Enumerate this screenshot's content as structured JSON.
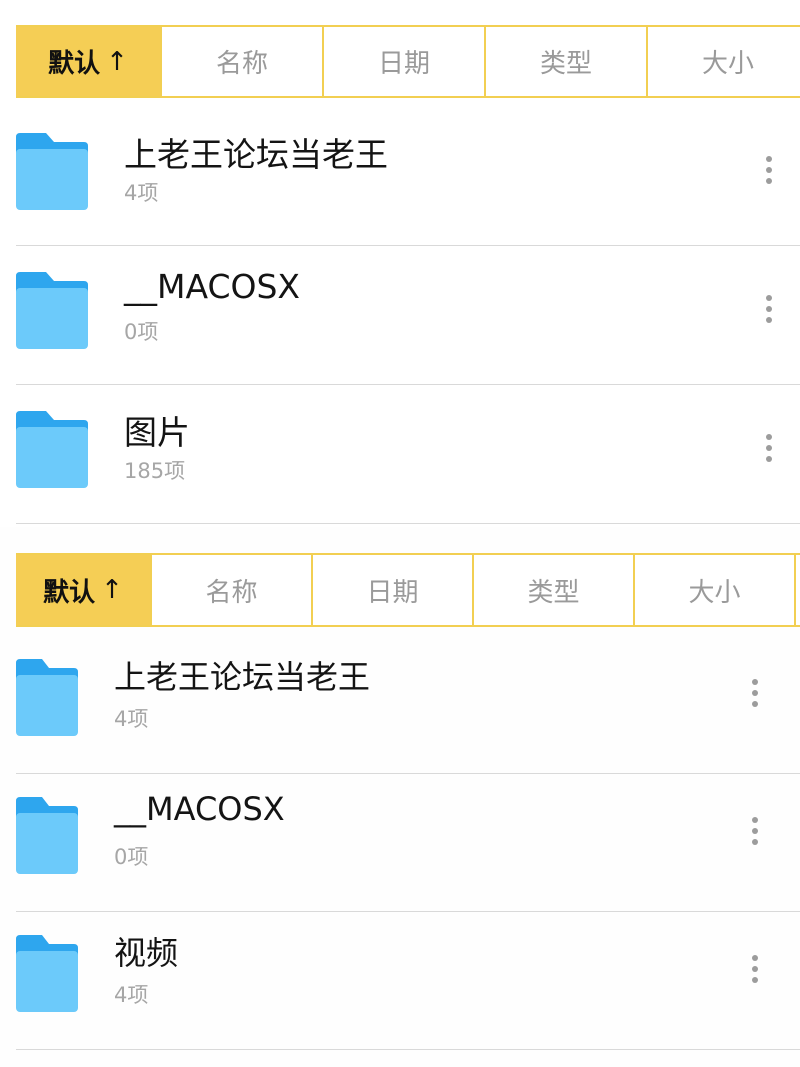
{
  "colors": {
    "accent": "#f5ce55",
    "tab_border": "#f2cf52",
    "folder_front": "#6ccafa",
    "folder_tab": "#2ea6ee",
    "muted_text": "#a6a6a6"
  },
  "panels": [
    {
      "sort_tabs": [
        {
          "label": "默认",
          "arrow": "↑",
          "active": true
        },
        {
          "label": "名称",
          "active": false
        },
        {
          "label": "日期",
          "active": false
        },
        {
          "label": "类型",
          "active": false
        },
        {
          "label": "大小",
          "active": false
        }
      ],
      "files": [
        {
          "name": "上老王论坛当老王",
          "count": "4项",
          "icon": "folder-icon"
        },
        {
          "name": "__MACOSX",
          "count": "0项",
          "icon": "folder-icon"
        },
        {
          "name": "图片",
          "count": "185项",
          "icon": "folder-icon"
        }
      ]
    },
    {
      "sort_tabs": [
        {
          "label": "默认",
          "arrow": "↑",
          "active": true
        },
        {
          "label": "名称",
          "active": false
        },
        {
          "label": "日期",
          "active": false
        },
        {
          "label": "类型",
          "active": false
        },
        {
          "label": "大小",
          "active": false
        }
      ],
      "files": [
        {
          "name": "上老王论坛当老王",
          "count": "4项",
          "icon": "folder-icon"
        },
        {
          "name": "__MACOSX",
          "count": "0项",
          "icon": "folder-icon"
        },
        {
          "name": "视频",
          "count": "4项",
          "icon": "folder-icon"
        }
      ]
    }
  ]
}
